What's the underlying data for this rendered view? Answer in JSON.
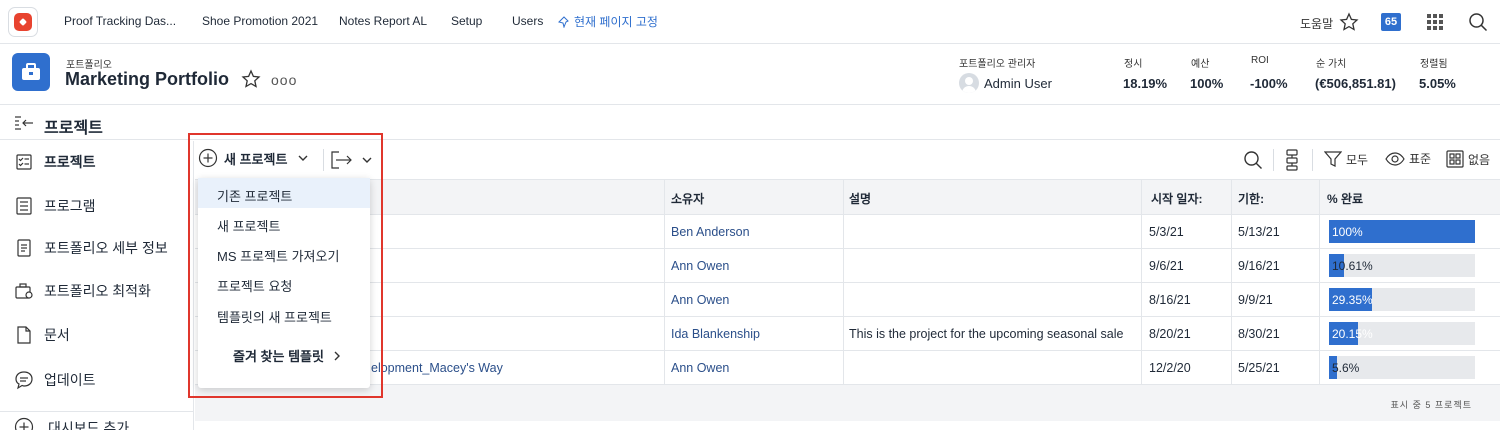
{
  "topnav": {
    "items": [
      "Proof Tracking Das...",
      "Shoe Promotion 2021",
      "Notes Report AL",
      "Setup",
      "Users"
    ],
    "pin_label": "현재 페이지 고정",
    "help_label": "도움말",
    "notification_count": "65"
  },
  "portfolio": {
    "breadcrumb": "포트폴리오",
    "title": "Marketing Portfolio",
    "more_label": "ooo",
    "manager_label": "포트폴리오 관리자",
    "manager_name": "Admin User",
    "metrics": [
      {
        "label": "정시",
        "value": "18.19%"
      },
      {
        "label": "예산",
        "value": "100%"
      },
      {
        "label": "ROI",
        "value": "-100%"
      },
      {
        "label": "순 가치",
        "value": "(€506,851.81)"
      },
      {
        "label": "정렬됨",
        "value": "5.05%"
      }
    ]
  },
  "section_title": "프로젝트",
  "sidebar": {
    "items": [
      {
        "label": "프로젝트",
        "icon": "checklist-icon"
      },
      {
        "label": "프로그램",
        "icon": "list-icon"
      },
      {
        "label": "포트폴리오 세부 정보",
        "icon": "document-icon"
      },
      {
        "label": "포트폴리오 최적화",
        "icon": "briefcase-gear-icon"
      },
      {
        "label": "문서",
        "icon": "file-icon"
      },
      {
        "label": "업데이트",
        "icon": "chat-icon"
      }
    ],
    "add_dashboard": "대시보드 추가"
  },
  "toolbar": {
    "new_project": "새 프로젝트",
    "filter_label": "모두",
    "view_label": "표준",
    "group_label": "없음"
  },
  "table": {
    "headers": [
      "소유자",
      "설명",
      "시작 일자:",
      "기한:",
      "% 완료"
    ],
    "rows": [
      {
        "name": "",
        "owner": "Ben Anderson",
        "desc": "",
        "start": "5/3/21",
        "due": "5/13/21",
        "pct": "100%",
        "pct_value": 1.0
      },
      {
        "name": "",
        "owner": "Ann Owen",
        "desc": "",
        "start": "9/6/21",
        "due": "9/16/21",
        "pct": "10.61%",
        "pct_value": 0.1061
      },
      {
        "name": "",
        "owner": "Ann Owen",
        "desc": "",
        "start": "8/16/21",
        "due": "9/9/21",
        "pct": "29.35%",
        "pct_value": 0.2935
      },
      {
        "name": "",
        "owner": "Ida Blankenship",
        "desc": "This is the project for the upcoming seasonal sale",
        "start": "8/20/21",
        "due": "8/30/21",
        "pct": "20.15%",
        "pct_value": 0.2015
      },
      {
        "name": "elopment_Macey's Way",
        "owner": "Ann Owen",
        "desc": "",
        "start": "12/2/20",
        "due": "5/25/21",
        "pct": "5.6%",
        "pct_value": 0.056
      }
    ],
    "footer": "표시 중 5 프로젝트"
  },
  "dropdown": {
    "items": [
      "기존 프로젝트",
      "새 프로젝트",
      "MS 프로젝트 가져오기",
      "프로젝트 요청",
      "템플릿의 새 프로젝트"
    ],
    "favorites": "즐겨 찾는 템플릿"
  },
  "colors": {
    "accent": "#2f6fce",
    "highlight": "#e0362c"
  }
}
